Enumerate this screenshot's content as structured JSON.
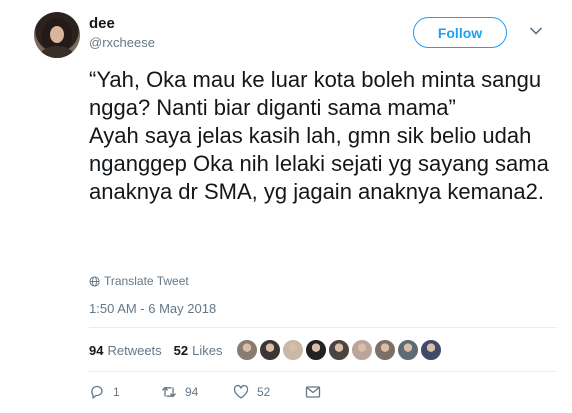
{
  "user": {
    "name": "dee",
    "handle": "@rxcheese"
  },
  "follow_label": "Follow",
  "tweet": {
    "text": "“Yah, Oka mau ke luar kota boleh minta sangu ngga? Nanti biar diganti sama mama”\nAyah saya jelas kasih lah, gmn sik belio udah nganggep Oka nih lelaki sejati yg sayang sama anaknya dr SMA, yg jagain anaknya kemana2.",
    "translate_label": "Translate Tweet",
    "timestamp": "1:50 AM - 6 May 2018"
  },
  "stats": {
    "retweets_count": "94",
    "retweets_label": "Retweets",
    "likes_count": "52",
    "likes_label": "Likes"
  },
  "liker_avatars": [
    "#8a7a70",
    "#3b3634",
    "#c9b8a8",
    "#222222",
    "#4b4440",
    "#b9a59a",
    "#7d6f66",
    "#5e6b73",
    "#3f4a66"
  ],
  "actions": {
    "reply_count": "1",
    "retweet_count": "94",
    "like_count": "52"
  },
  "colors": {
    "accent": "#1da1f2",
    "secondary_text": "#657786",
    "divider": "#e6ecf0"
  }
}
